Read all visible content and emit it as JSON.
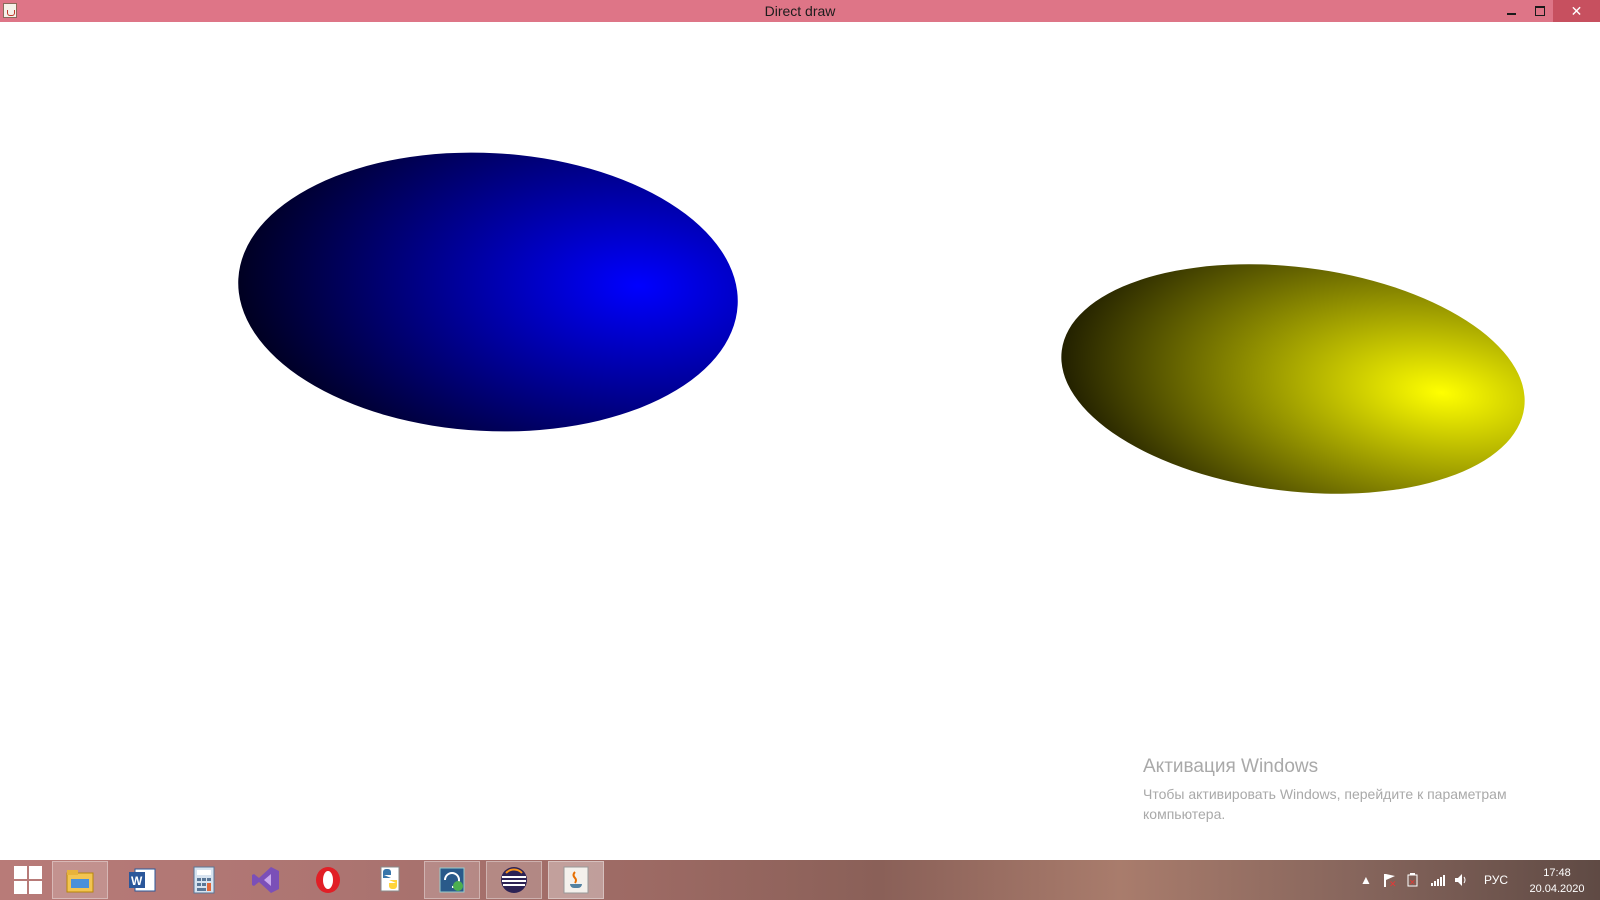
{
  "window": {
    "title": "Direct draw",
    "buttons": {
      "minimize": "–",
      "maximize": "❐",
      "close": "✕"
    }
  },
  "canvas": {
    "shapes": [
      {
        "name": "blue-ellipse",
        "color": "#0000ff",
        "shade": "#000014"
      },
      {
        "name": "yellow-ellipse",
        "color": "#ffff00",
        "shade": "#1a1800"
      }
    ]
  },
  "activation": {
    "title": "Активация Windows",
    "text": "Чтобы активировать Windows, перейдите к параметрам компьютера."
  },
  "taskbar": {
    "items": [
      {
        "name": "start-button",
        "icon": "windows-logo-icon"
      },
      {
        "name": "file-explorer",
        "icon": "folder-icon"
      },
      {
        "name": "word",
        "icon": "word-icon"
      },
      {
        "name": "calculator",
        "icon": "calculator-icon"
      },
      {
        "name": "visual-studio",
        "icon": "visual-studio-icon"
      },
      {
        "name": "opera",
        "icon": "opera-icon"
      },
      {
        "name": "python",
        "icon": "python-icon"
      },
      {
        "name": "network-tool",
        "icon": "network-app-icon"
      },
      {
        "name": "eclipse",
        "icon": "eclipse-icon"
      },
      {
        "name": "java-app",
        "icon": "java-icon"
      }
    ],
    "tray": {
      "language": "РУС",
      "time": "17:48",
      "date": "20.04.2020"
    }
  }
}
